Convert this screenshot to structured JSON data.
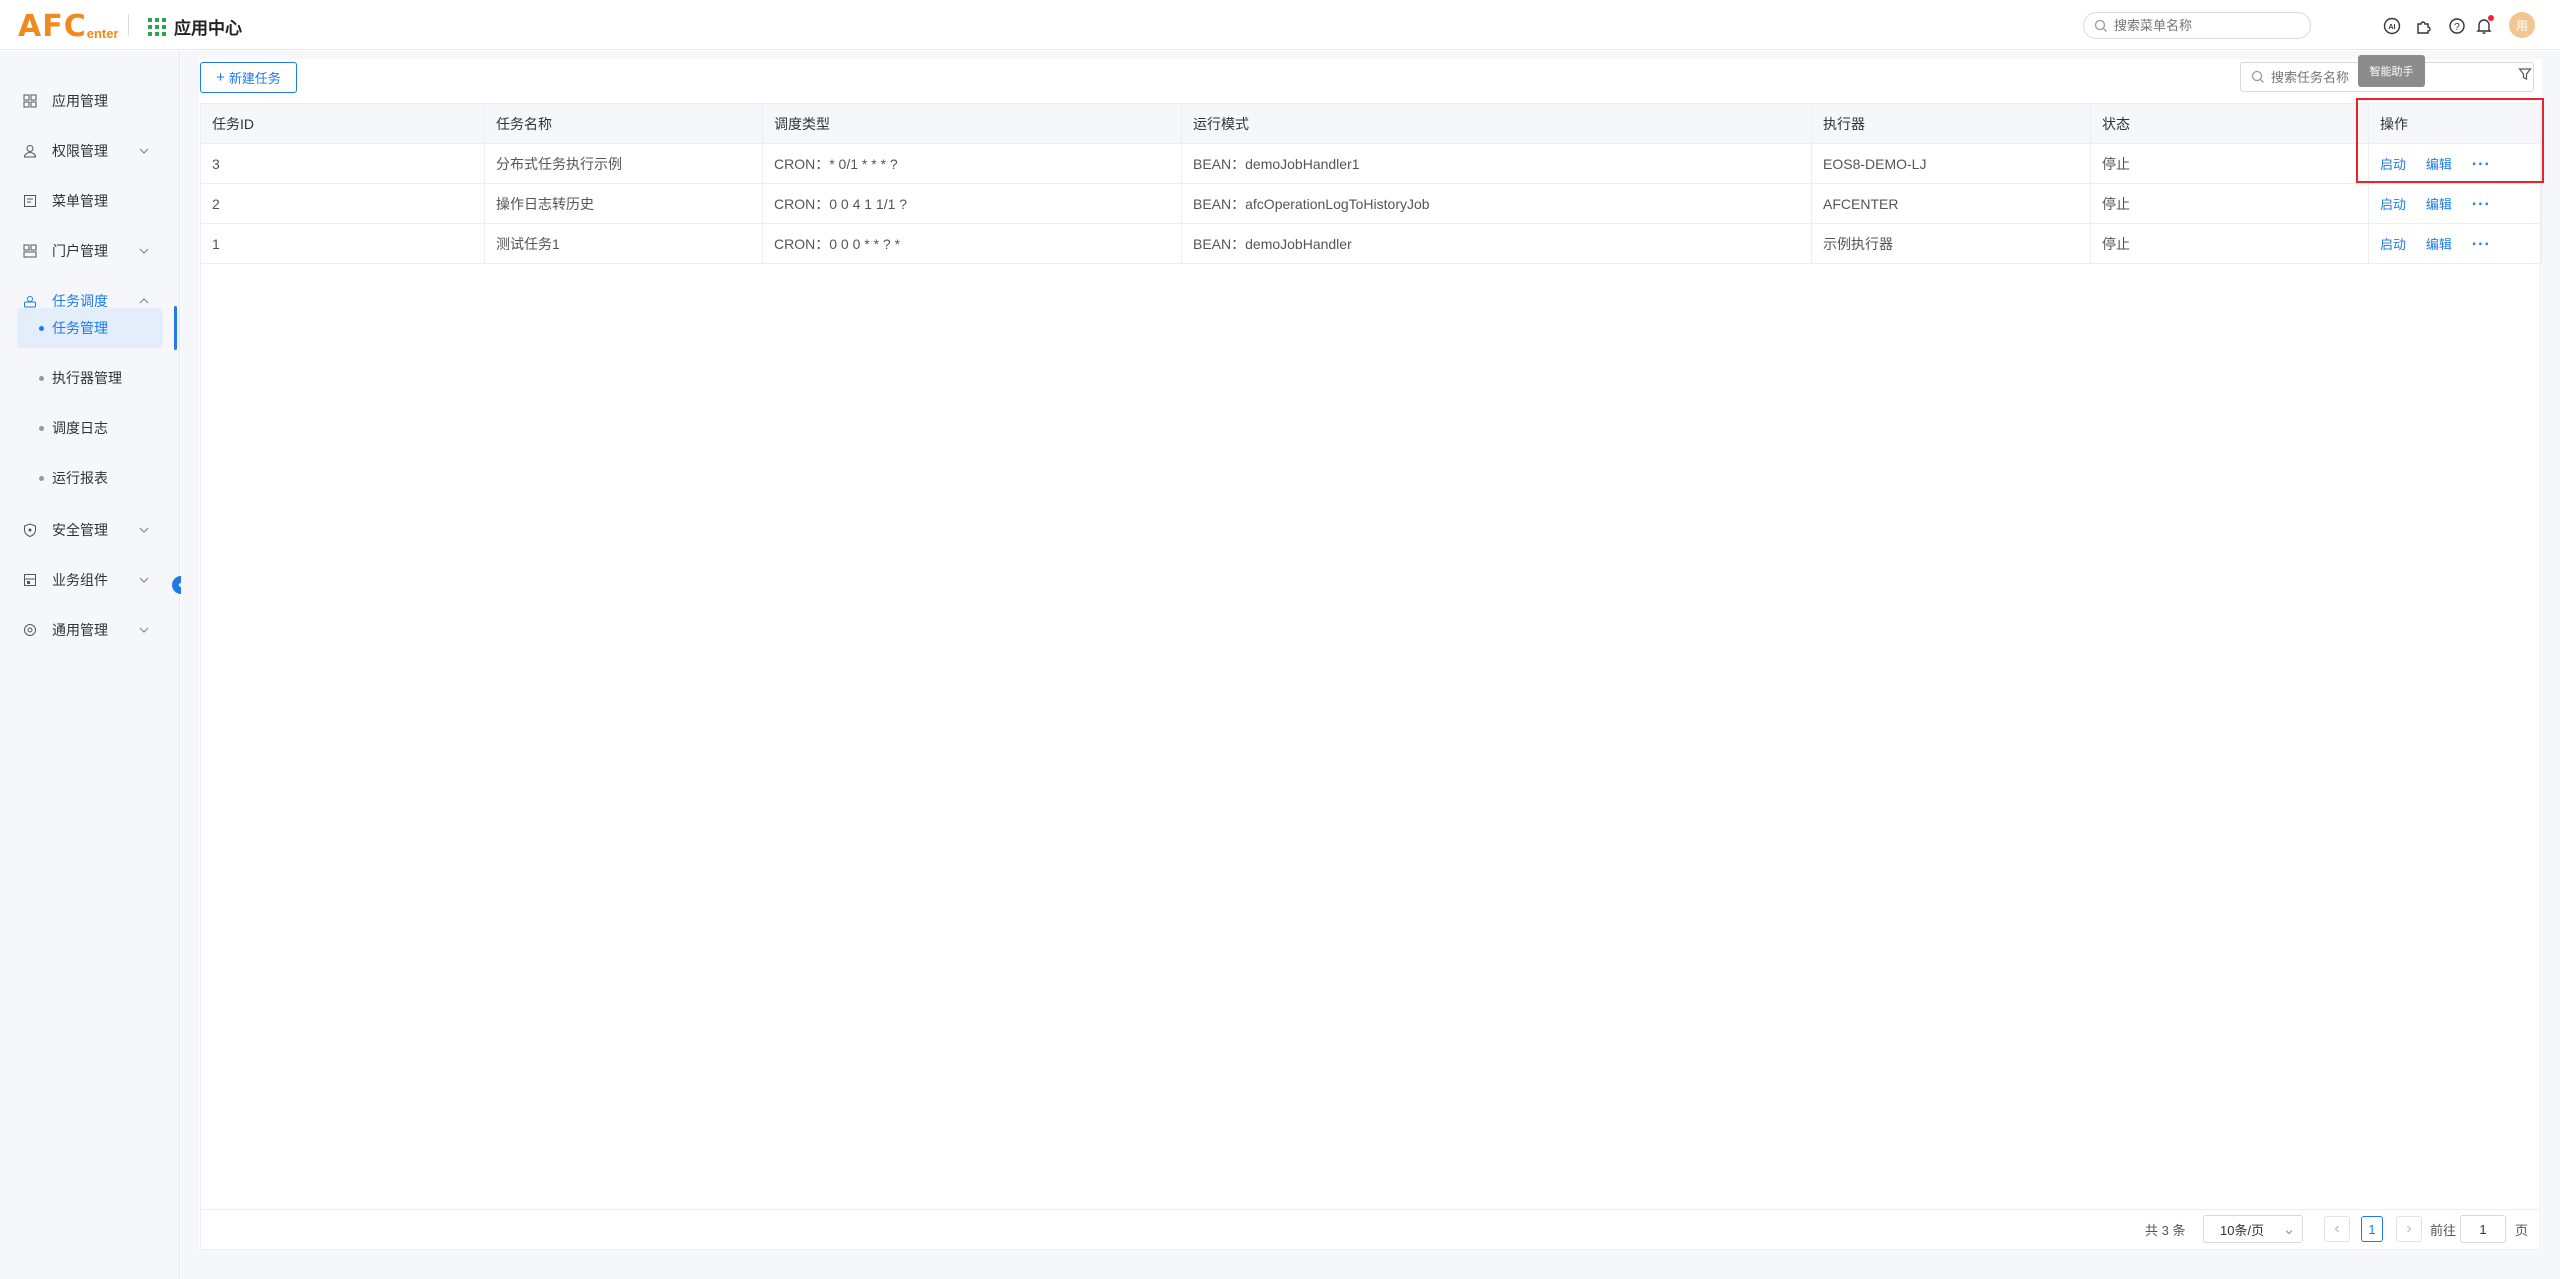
{
  "header": {
    "logo_big": "AFC",
    "logo_small": "enter",
    "app_title": "应用中心",
    "menu_search_placeholder": "搜索菜单名称",
    "avatar_text": "用"
  },
  "tooltip": "智能助手",
  "sidebar": {
    "items": [
      {
        "label": "应用管理",
        "icon": "apps-icon"
      },
      {
        "label": "权限管理",
        "icon": "person-icon"
      },
      {
        "label": "菜单管理",
        "icon": "menu-doc-icon"
      },
      {
        "label": "门户管理",
        "icon": "portal-icon"
      },
      {
        "label": "任务调度",
        "icon": "scheduler-icon"
      },
      {
        "label": "安全管理",
        "icon": "shield-icon"
      },
      {
        "label": "业务组件",
        "icon": "component-icon"
      },
      {
        "label": "通用管理",
        "icon": "settings-circle-icon"
      }
    ],
    "sub_items": [
      {
        "label": "任务管理",
        "active": true
      },
      {
        "label": "执行器管理"
      },
      {
        "label": "调度日志"
      },
      {
        "label": "运行报表"
      }
    ]
  },
  "toolbar": {
    "new_task_label": "新建任务",
    "task_search_placeholder": "搜索任务名称"
  },
  "table": {
    "columns": [
      "任务ID",
      "任务名称",
      "调度类型",
      "运行模式",
      "执行器",
      "状态",
      "操作"
    ],
    "rows": [
      {
        "id": "3",
        "name": "分布式任务执行示例",
        "schedule": "CRON：* 0/1 * * * ?",
        "mode": "BEAN：demoJobHandler1",
        "executor": "EOS8-DEMO-LJ",
        "status": "停止"
      },
      {
        "id": "2",
        "name": "操作日志转历史",
        "schedule": "CRON：0 0 4 1 1/1 ?",
        "mode": "BEAN：afcOperationLogToHistoryJob",
        "executor": "AFCENTER",
        "status": "停止"
      },
      {
        "id": "1",
        "name": "测试任务1",
        "schedule": "CRON：0 0 0 * * ? *",
        "mode": "BEAN：demoJobHandler",
        "executor": "示例执行器",
        "status": "停止"
      }
    ],
    "actions": {
      "start": "启动",
      "edit": "编辑",
      "more": "···"
    }
  },
  "pagination": {
    "total": "共 3 条",
    "page_size": "10条/页",
    "current_page": "1",
    "goto_prefix": "前往",
    "goto_value": "1",
    "goto_suffix": "页"
  },
  "colors": {
    "accent": "#1e7be8",
    "brand_orange": "#f08a1c",
    "highlight_red": "#e8242b"
  }
}
